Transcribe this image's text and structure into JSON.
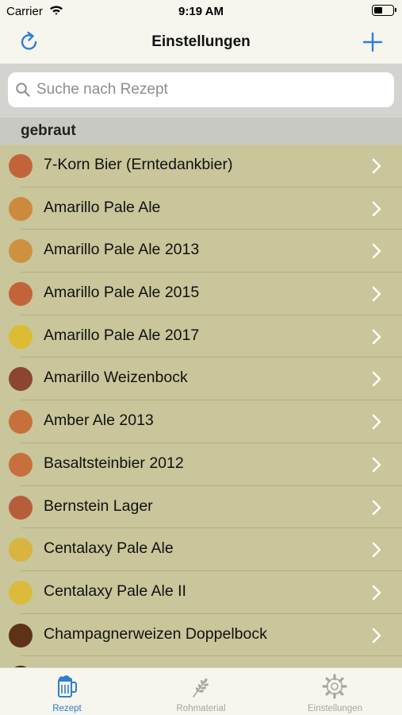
{
  "status_bar": {
    "carrier": "Carrier",
    "time": "9:19 AM"
  },
  "nav": {
    "title": "Einstellungen",
    "left_icon": "refresh-icon",
    "right_icon": "plus-icon",
    "accent_color": "#2f7fd0"
  },
  "search": {
    "placeholder": "Suche nach Rezept",
    "value": ""
  },
  "section": {
    "title": "gebraut"
  },
  "recipes": [
    {
      "name": "7-Korn Bier (Erntedankbier)",
      "color": "#c2643a"
    },
    {
      "name": "Amarillo Pale Ale",
      "color": "#cd8a3d"
    },
    {
      "name": "Amarillo Pale Ale 2013",
      "color": "#cd9240"
    },
    {
      "name": "Amarillo Pale Ale 2015",
      "color": "#c2643a"
    },
    {
      "name": "Amarillo Pale Ale 2017",
      "color": "#dcbb35"
    },
    {
      "name": "Amarillo Weizenbock",
      "color": "#8a4630"
    },
    {
      "name": "Amber Ale 2013",
      "color": "#c8703c"
    },
    {
      "name": "Basaltsteinbier 2012",
      "color": "#c8703c"
    },
    {
      "name": "Bernstein Lager",
      "color": "#b65e3c"
    },
    {
      "name": "Centalaxy Pale Ale",
      "color": "#d8b440"
    },
    {
      "name": "Centalaxy Pale Ale II",
      "color": "#dcbb3c"
    },
    {
      "name": "Champagnerweizen Doppelbock",
      "color": "#5d3219"
    },
    {
      "name": "",
      "color": "#3a2418"
    }
  ],
  "tabs": [
    {
      "label": "Rezept",
      "icon": "beer-mug-icon",
      "active": true
    },
    {
      "label": "Rohmaterial",
      "icon": "wheat-icon",
      "active": false
    },
    {
      "label": "Einstellungen",
      "icon": "gear-icon",
      "active": false
    }
  ]
}
